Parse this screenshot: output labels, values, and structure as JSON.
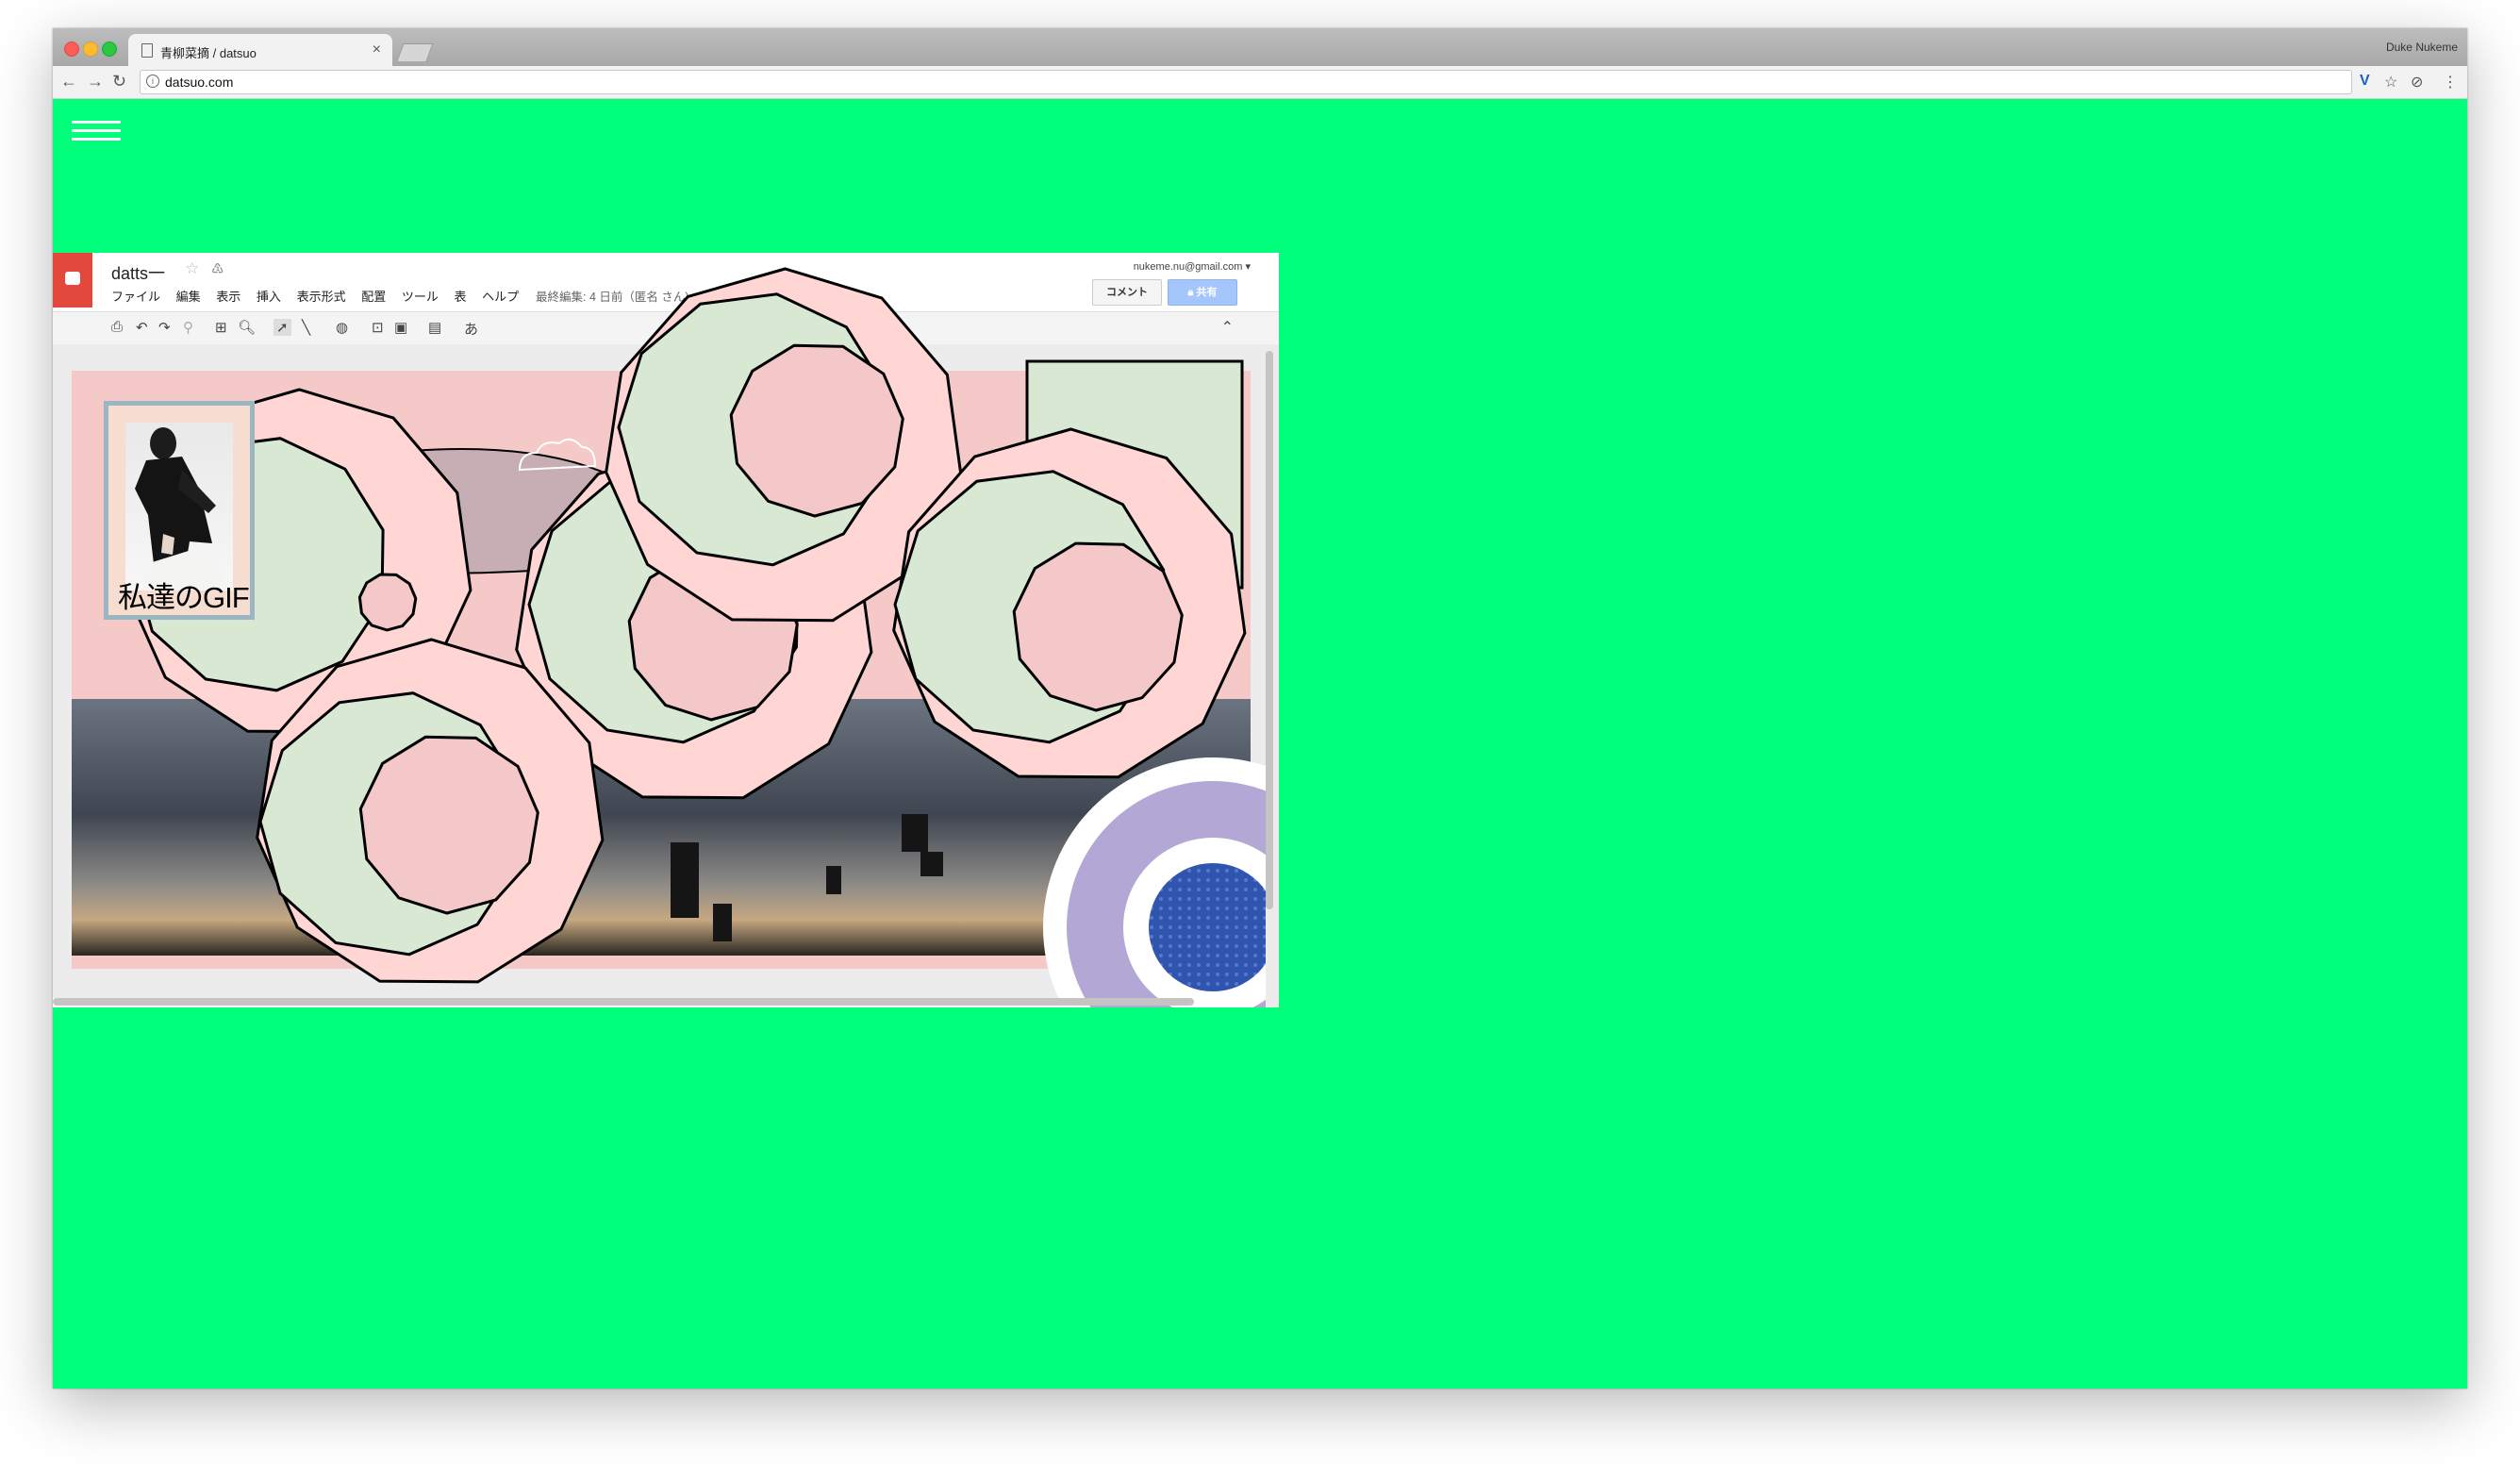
{
  "browser": {
    "tab_title": "青柳菜摘 / datsuo",
    "url": "datsuo.com",
    "profile_name": "Duke Nukeme",
    "close_icon": "×",
    "back_icon": "←",
    "forward_icon": "→",
    "reload_icon": "↻",
    "bookmark_icon": "☆",
    "extension_icon": "V",
    "menu_icon": "⋮"
  },
  "slides_app": {
    "doc_title": "datts一",
    "account": "nukeme.nu@gmail.com",
    "account_caret": "▾",
    "menu": [
      "ファイル",
      "編集",
      "表示",
      "挿入",
      "表示形式",
      "配置",
      "ツール",
      "表",
      "ヘルプ"
    ],
    "last_edit": "最終編集: 4 日前（匿名 さん)",
    "comment_label": "コメント",
    "share_label": "共有",
    "input_tool_label": "あ",
    "star_icon": "☆",
    "drive_icon": "♳"
  },
  "slide": {
    "gif_caption": "私達のGIF"
  },
  "colors": {
    "page_background": "#00ff7a",
    "slide_background": "#f4c9c8",
    "polygon_ring": "#ffd6d4",
    "polygon_moon": "#d8e8d2",
    "polygon_core": "#f4c8c8",
    "right_rect": "#d8e8d2",
    "circle_outer": "#b3a8d5",
    "circle_core": "#2f55b0"
  }
}
